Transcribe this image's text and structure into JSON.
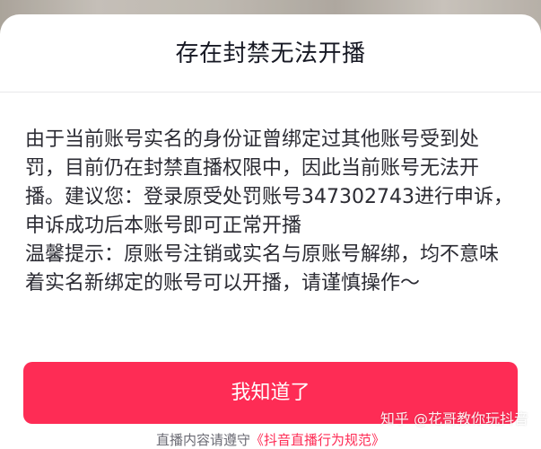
{
  "dialog": {
    "title": "存在封禁无法开播",
    "message_lines": [
      "由于当前账号实名的身份证曾绑定过其他账号受到处",
      "罚，目前仍在封禁直播权限中，因此当前账号无法开",
      "播。建议您：登录原受处罚账号347302743进行申诉，",
      "申诉成功后本账号即可正常开播",
      "温馨提示：原账号注销或实名与原账号解绑，均不意味",
      "着实名新绑定的账号可以开播，请谨慎操作～"
    ],
    "confirm_label": "我知道了"
  },
  "footer": {
    "prefix": "直播内容请遵守",
    "link_text": "《抖音直播行为规范》"
  },
  "watermark": {
    "text": "知乎 @花哥教你玩抖音"
  },
  "colors": {
    "accent": "#fe2c55",
    "title_text": "#161823",
    "body_text": "#2b2b33"
  }
}
